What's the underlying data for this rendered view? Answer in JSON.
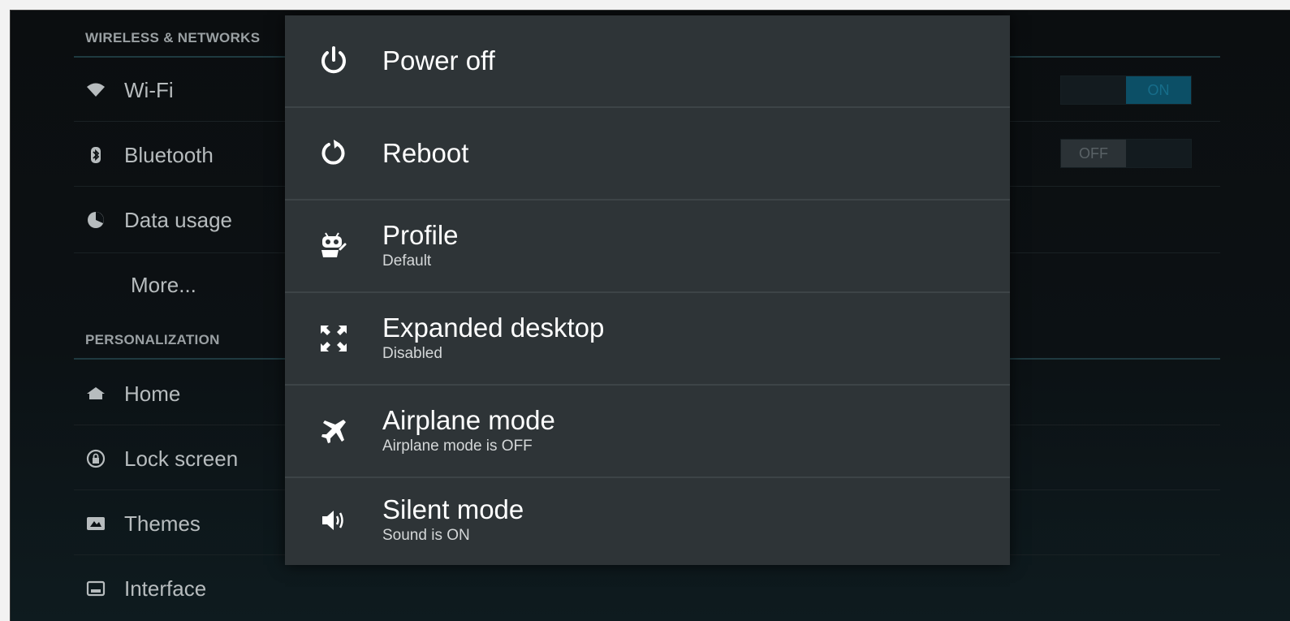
{
  "background_settings": {
    "sections": [
      {
        "header": "WIRELESS & NETWORKS",
        "items": [
          {
            "label": "Wi-Fi",
            "icon": "wifi-icon",
            "toggle": "ON"
          },
          {
            "label": "Bluetooth",
            "icon": "bluetooth-icon",
            "toggle": "OFF"
          },
          {
            "label": "Data usage",
            "icon": "data-usage-icon"
          },
          {
            "label": "More..."
          }
        ]
      },
      {
        "header": "PERSONALIZATION",
        "items": [
          {
            "label": "Home",
            "icon": "home-icon"
          },
          {
            "label": "Lock screen",
            "icon": "lock-icon"
          },
          {
            "label": "Themes",
            "icon": "themes-icon"
          },
          {
            "label": "Interface",
            "icon": "interface-icon"
          }
        ]
      }
    ]
  },
  "power_menu": {
    "items": [
      {
        "title": "Power off",
        "subtitle": "",
        "icon": "power-icon"
      },
      {
        "title": "Reboot",
        "subtitle": "",
        "icon": "reboot-icon"
      },
      {
        "title": "Profile",
        "subtitle": "Default",
        "icon": "profile-robot-icon"
      },
      {
        "title": "Expanded desktop",
        "subtitle": "Disabled",
        "icon": "expand-arrows-icon"
      },
      {
        "title": "Airplane mode",
        "subtitle": "Airplane mode is OFF",
        "icon": "airplane-icon"
      },
      {
        "title": "Silent mode",
        "subtitle": "Sound is ON",
        "icon": "speaker-icon"
      }
    ]
  },
  "colors": {
    "background": "#0c1114",
    "menu_background": "#2e3437",
    "accent": "#0c4f66",
    "text_primary": "#ffffff"
  }
}
